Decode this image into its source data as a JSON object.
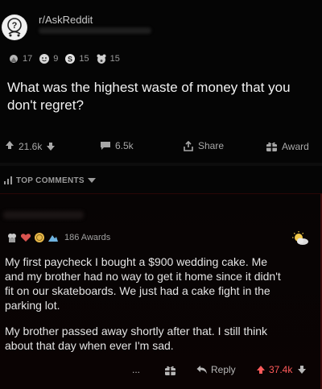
{
  "post": {
    "subreddit": "r/AskReddit",
    "awards": [
      {
        "icon": "helpful-award-icon",
        "count": "17"
      },
      {
        "icon": "wholesome-award-icon",
        "count": "9"
      },
      {
        "icon": "silver-award-icon",
        "count": "15"
      },
      {
        "icon": "bear-award-icon",
        "count": "15"
      }
    ],
    "title": "What was the highest waste of money that you don't regret?",
    "upvotes": "21.6k",
    "comments": "6.5k",
    "share_label": "Share",
    "award_label": "Award"
  },
  "sort": {
    "label": "TOP COMMENTS"
  },
  "comment": {
    "awards_label": "186 Awards",
    "paragraphs": [
      "My first paycheck I bought a $900 wedding cake. Me and my brother had no way to get it home since it didn't fit on our skateboards. We just had a cake fight in the parking lot.",
      "My brother passed away shortly after that. I still think about that day when ever I'm sad."
    ],
    "lines": [
      [
        "My first paycheck I bought a $900 wedding cake. Me",
        "and my brother had no way to get it home since it didn't",
        "fit on our skateboards. We just had a cake fight in the",
        "parking lot."
      ],
      [
        "My brother passed away shortly after that. I still think",
        "about that day when ever I'm sad."
      ]
    ],
    "more_label": "...",
    "reply_label": "Reply",
    "votes": "37.4k"
  },
  "colors": {
    "upvote_red": "#ff5a5a",
    "award_gold": "#e8b84a",
    "background": "#050505"
  }
}
